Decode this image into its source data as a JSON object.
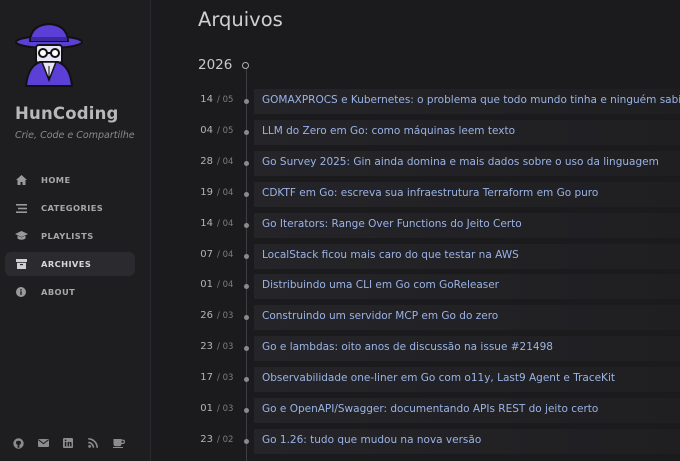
{
  "sidebar": {
    "site_title": "HunCoding",
    "site_subtitle": "Crie, Code e Compartilhe",
    "nav": [
      {
        "label": "HOME",
        "icon": "home-icon"
      },
      {
        "label": "CATEGORIES",
        "icon": "stream-icon"
      },
      {
        "label": "PLAYLISTS",
        "icon": "graduation-cap-icon"
      },
      {
        "label": "ARCHIVES",
        "icon": "archive-icon",
        "active": true
      },
      {
        "label": "ABOUT",
        "icon": "info-circle-icon"
      }
    ],
    "social": [
      "github-icon",
      "email-icon",
      "linkedin-icon",
      "rss-icon",
      "coffee-icon"
    ]
  },
  "main": {
    "page_title": "Arquivos",
    "year": "2026",
    "posts": [
      {
        "day": "14",
        "month": "/ 05",
        "title": "GOMAXPROCS e Kubernetes: o problema que todo mundo tinha e ninguém sabia"
      },
      {
        "day": "04",
        "month": "/ 05",
        "title": "LLM do Zero em Go: como máquinas leem texto"
      },
      {
        "day": "28",
        "month": "/ 04",
        "title": "Go Survey 2025: Gin ainda domina e mais dados sobre o uso da linguagem"
      },
      {
        "day": "19",
        "month": "/ 04",
        "title": "CDKTF em Go: escreva sua infraestrutura Terraform em Go puro"
      },
      {
        "day": "14",
        "month": "/ 04",
        "title": "Go Iterators: Range Over Functions do Jeito Certo"
      },
      {
        "day": "07",
        "month": "/ 04",
        "title": "LocalStack ficou mais caro do que testar na AWS"
      },
      {
        "day": "01",
        "month": "/ 04",
        "title": "Distribuindo uma CLI em Go com GoReleaser"
      },
      {
        "day": "26",
        "month": "/ 03",
        "title": "Construindo um servidor MCP em Go do zero"
      },
      {
        "day": "23",
        "month": "/ 03",
        "title": "Go e lambdas: oito anos de discussão na issue #21498"
      },
      {
        "day": "17",
        "month": "/ 03",
        "title": "Observabilidade one-liner em Go com o11y, Last9 Agent e TraceKit"
      },
      {
        "day": "01",
        "month": "/ 03",
        "title": "Go e OpenAPI/Swagger: documentando APIs REST do jeito certo"
      },
      {
        "day": "23",
        "month": "/ 02",
        "title": "Go 1.26: tudo que mudou na nova versão"
      }
    ]
  },
  "colors": {
    "background": "#1b1b1e",
    "sidebar": "#1e1e21",
    "link": "#9ab3e6",
    "avatar_purple": "#5b3fd6"
  }
}
